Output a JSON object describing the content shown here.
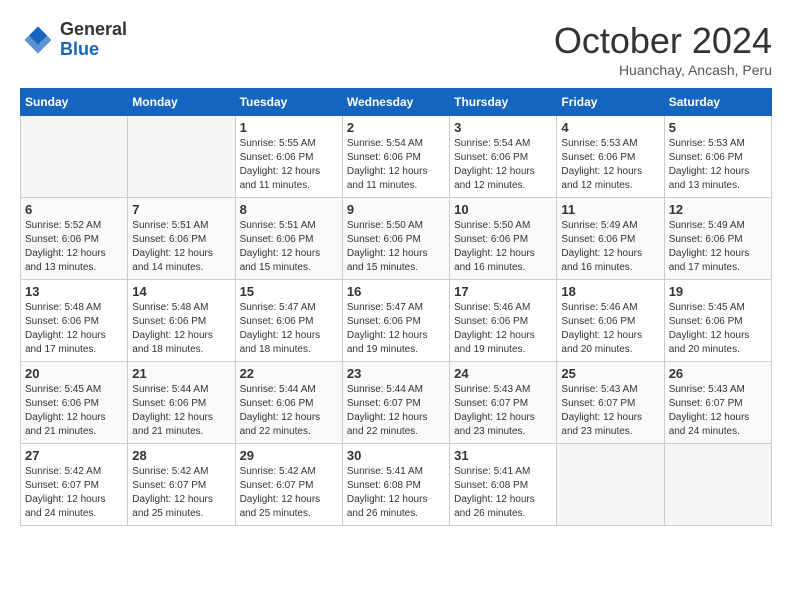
{
  "header": {
    "logo_general": "General",
    "logo_blue": "Blue",
    "month_title": "October 2024",
    "subtitle": "Huanchay, Ancash, Peru"
  },
  "days_of_week": [
    "Sunday",
    "Monday",
    "Tuesday",
    "Wednesday",
    "Thursday",
    "Friday",
    "Saturday"
  ],
  "weeks": [
    [
      {
        "day": null
      },
      {
        "day": null
      },
      {
        "day": "1",
        "sunrise": "Sunrise: 5:55 AM",
        "sunset": "Sunset: 6:06 PM",
        "daylight": "Daylight: 12 hours and 11 minutes."
      },
      {
        "day": "2",
        "sunrise": "Sunrise: 5:54 AM",
        "sunset": "Sunset: 6:06 PM",
        "daylight": "Daylight: 12 hours and 11 minutes."
      },
      {
        "day": "3",
        "sunrise": "Sunrise: 5:54 AM",
        "sunset": "Sunset: 6:06 PM",
        "daylight": "Daylight: 12 hours and 12 minutes."
      },
      {
        "day": "4",
        "sunrise": "Sunrise: 5:53 AM",
        "sunset": "Sunset: 6:06 PM",
        "daylight": "Daylight: 12 hours and 12 minutes."
      },
      {
        "day": "5",
        "sunrise": "Sunrise: 5:53 AM",
        "sunset": "Sunset: 6:06 PM",
        "daylight": "Daylight: 12 hours and 13 minutes."
      }
    ],
    [
      {
        "day": "6",
        "sunrise": "Sunrise: 5:52 AM",
        "sunset": "Sunset: 6:06 PM",
        "daylight": "Daylight: 12 hours and 13 minutes."
      },
      {
        "day": "7",
        "sunrise": "Sunrise: 5:51 AM",
        "sunset": "Sunset: 6:06 PM",
        "daylight": "Daylight: 12 hours and 14 minutes."
      },
      {
        "day": "8",
        "sunrise": "Sunrise: 5:51 AM",
        "sunset": "Sunset: 6:06 PM",
        "daylight": "Daylight: 12 hours and 15 minutes."
      },
      {
        "day": "9",
        "sunrise": "Sunrise: 5:50 AM",
        "sunset": "Sunset: 6:06 PM",
        "daylight": "Daylight: 12 hours and 15 minutes."
      },
      {
        "day": "10",
        "sunrise": "Sunrise: 5:50 AM",
        "sunset": "Sunset: 6:06 PM",
        "daylight": "Daylight: 12 hours and 16 minutes."
      },
      {
        "day": "11",
        "sunrise": "Sunrise: 5:49 AM",
        "sunset": "Sunset: 6:06 PM",
        "daylight": "Daylight: 12 hours and 16 minutes."
      },
      {
        "day": "12",
        "sunrise": "Sunrise: 5:49 AM",
        "sunset": "Sunset: 6:06 PM",
        "daylight": "Daylight: 12 hours and 17 minutes."
      }
    ],
    [
      {
        "day": "13",
        "sunrise": "Sunrise: 5:48 AM",
        "sunset": "Sunset: 6:06 PM",
        "daylight": "Daylight: 12 hours and 17 minutes."
      },
      {
        "day": "14",
        "sunrise": "Sunrise: 5:48 AM",
        "sunset": "Sunset: 6:06 PM",
        "daylight": "Daylight: 12 hours and 18 minutes."
      },
      {
        "day": "15",
        "sunrise": "Sunrise: 5:47 AM",
        "sunset": "Sunset: 6:06 PM",
        "daylight": "Daylight: 12 hours and 18 minutes."
      },
      {
        "day": "16",
        "sunrise": "Sunrise: 5:47 AM",
        "sunset": "Sunset: 6:06 PM",
        "daylight": "Daylight: 12 hours and 19 minutes."
      },
      {
        "day": "17",
        "sunrise": "Sunrise: 5:46 AM",
        "sunset": "Sunset: 6:06 PM",
        "daylight": "Daylight: 12 hours and 19 minutes."
      },
      {
        "day": "18",
        "sunrise": "Sunrise: 5:46 AM",
        "sunset": "Sunset: 6:06 PM",
        "daylight": "Daylight: 12 hours and 20 minutes."
      },
      {
        "day": "19",
        "sunrise": "Sunrise: 5:45 AM",
        "sunset": "Sunset: 6:06 PM",
        "daylight": "Daylight: 12 hours and 20 minutes."
      }
    ],
    [
      {
        "day": "20",
        "sunrise": "Sunrise: 5:45 AM",
        "sunset": "Sunset: 6:06 PM",
        "daylight": "Daylight: 12 hours and 21 minutes."
      },
      {
        "day": "21",
        "sunrise": "Sunrise: 5:44 AM",
        "sunset": "Sunset: 6:06 PM",
        "daylight": "Daylight: 12 hours and 21 minutes."
      },
      {
        "day": "22",
        "sunrise": "Sunrise: 5:44 AM",
        "sunset": "Sunset: 6:06 PM",
        "daylight": "Daylight: 12 hours and 22 minutes."
      },
      {
        "day": "23",
        "sunrise": "Sunrise: 5:44 AM",
        "sunset": "Sunset: 6:07 PM",
        "daylight": "Daylight: 12 hours and 22 minutes."
      },
      {
        "day": "24",
        "sunrise": "Sunrise: 5:43 AM",
        "sunset": "Sunset: 6:07 PM",
        "daylight": "Daylight: 12 hours and 23 minutes."
      },
      {
        "day": "25",
        "sunrise": "Sunrise: 5:43 AM",
        "sunset": "Sunset: 6:07 PM",
        "daylight": "Daylight: 12 hours and 23 minutes."
      },
      {
        "day": "26",
        "sunrise": "Sunrise: 5:43 AM",
        "sunset": "Sunset: 6:07 PM",
        "daylight": "Daylight: 12 hours and 24 minutes."
      }
    ],
    [
      {
        "day": "27",
        "sunrise": "Sunrise: 5:42 AM",
        "sunset": "Sunset: 6:07 PM",
        "daylight": "Daylight: 12 hours and 24 minutes."
      },
      {
        "day": "28",
        "sunrise": "Sunrise: 5:42 AM",
        "sunset": "Sunset: 6:07 PM",
        "daylight": "Daylight: 12 hours and 25 minutes."
      },
      {
        "day": "29",
        "sunrise": "Sunrise: 5:42 AM",
        "sunset": "Sunset: 6:07 PM",
        "daylight": "Daylight: 12 hours and 25 minutes."
      },
      {
        "day": "30",
        "sunrise": "Sunrise: 5:41 AM",
        "sunset": "Sunset: 6:08 PM",
        "daylight": "Daylight: 12 hours and 26 minutes."
      },
      {
        "day": "31",
        "sunrise": "Sunrise: 5:41 AM",
        "sunset": "Sunset: 6:08 PM",
        "daylight": "Daylight: 12 hours and 26 minutes."
      },
      {
        "day": null
      },
      {
        "day": null
      }
    ]
  ]
}
